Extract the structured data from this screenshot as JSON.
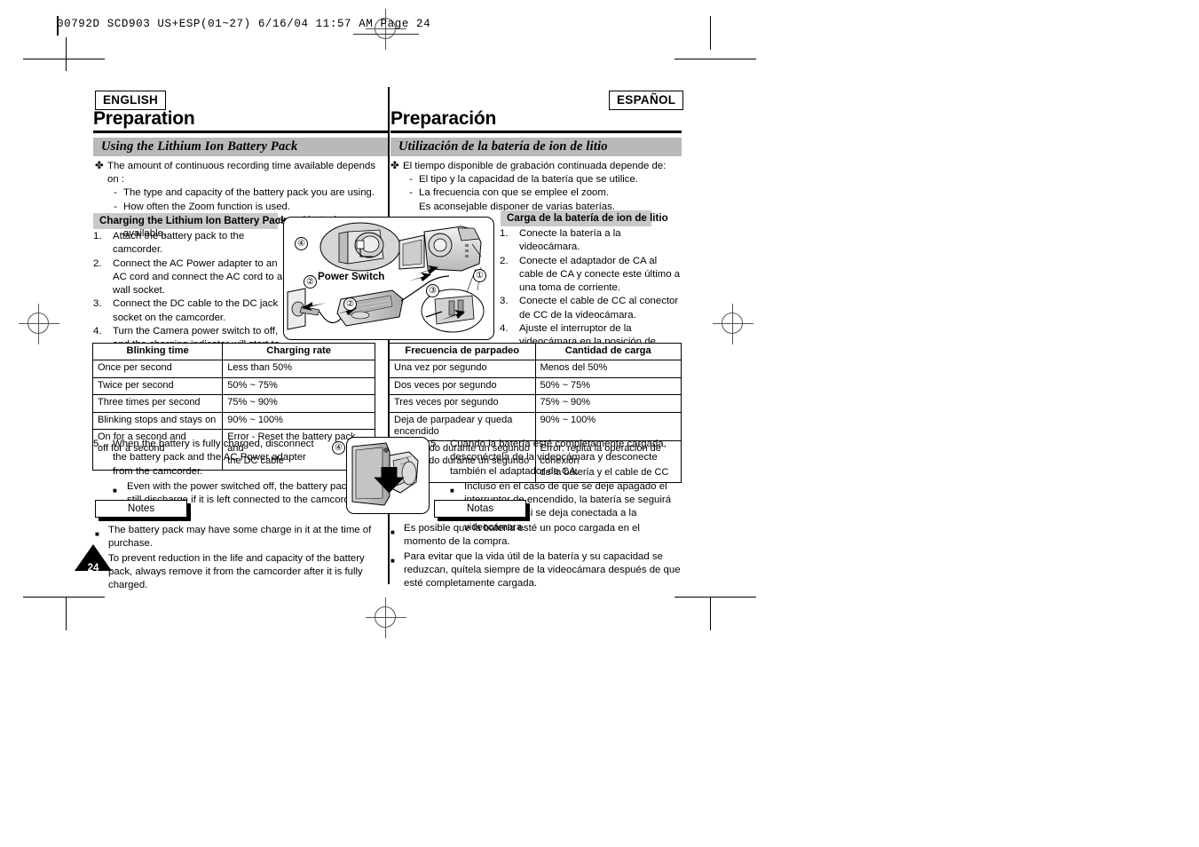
{
  "file_header": {
    "text": "00792D  SCD903  US+ESP(01~27)   6/16/04  11:57 AM   Page 24"
  },
  "page_number": "24",
  "english": {
    "lang_tag": "ENGLISH",
    "title": "Preparation",
    "section_heading": "Using the Lithium Ion Battery Pack",
    "intro": {
      "lead": "The amount of continuous recording time available depends on :",
      "sub_items": [
        "The type and capacity of the battery pack you are using.",
        "How often the Zoom function is used."
      ],
      "note_line": "It is recommended that you have several batteries available."
    },
    "charging_heading": "Charging the Lithium Ion Battery Pack",
    "steps": [
      {
        "num": "1.",
        "text": "Attach the battery pack to the camcorder."
      },
      {
        "num": "2.",
        "text": "Connect the AC Power adapter to an AC cord and connect the AC cord to a wall socket."
      },
      {
        "num": "3.",
        "text": "Connect the DC cable to the DC jack socket on the camcorder."
      },
      {
        "num": "4.",
        "text": "Turn the Camera power switch to off, and the charging indicator will start to flash, showing that the battery is charging."
      }
    ],
    "table": {
      "headers": [
        "Blinking time",
        "Charging rate"
      ],
      "rows": [
        [
          "Once per second",
          "Less than 50%"
        ],
        [
          "Twice per second",
          "50% ~ 75%"
        ],
        [
          "Three times per second",
          "75%  ~  90%"
        ],
        [
          "Blinking stops and stays on",
          "90% ~ 100%"
        ],
        [
          "On for a second and\noff for a second",
          "Error - Reset the battery pack and\nthe DC cable"
        ]
      ]
    },
    "step5": {
      "num": "5.",
      "text": "When the battery is fully charged, disconnect the battery pack and the AC Power adapter from the camcorder.",
      "sub": "Even with the power switched off, the battery pack will still discharge if it is left connected to the camcorder."
    },
    "notes_label": "Notes",
    "notes": [
      "The battery pack may have some charge in it at the time of purchase.",
      "To prevent reduction in the life and capacity of the battery pack, always remove it from the camcorder after it is fully charged."
    ]
  },
  "spanish": {
    "lang_tag": "ESPAÑOL",
    "title": "Preparación",
    "section_heading": "Utilización de la batería de ion de litio",
    "intro": {
      "lead": "El tiempo disponible de grabación continuada depende de:",
      "sub_items": [
        "El tipo y la capacidad de la batería que se utilice.",
        "La frecuencia con que se emplee el zoom."
      ],
      "note_line": "Es aconsejable disponer de varias baterías."
    },
    "charging_heading": "Carga de la batería de ion de litio",
    "steps": [
      {
        "num": "1.",
        "text": "Conecte la batería a la videocámara."
      },
      {
        "num": "2.",
        "text": "Conecte el adaptador de CA al cable de CA y conecte este último a una toma de corriente."
      },
      {
        "num": "3.",
        "text": "Conecte el cable de CC al conector de CC de la videocámara."
      },
      {
        "num": "4.",
        "text": "Ajuste el interruptor de la videocámara en la posición de apagado. El indicador de carga empezará a parpadear, lo que indica que la batería se está cargando."
      }
    ],
    "table": {
      "headers": [
        "Frecuencia de parpadeo",
        "Cantidad de carga"
      ],
      "rows": [
        [
          "Una vez por segundo",
          "Menos del 50%"
        ],
        [
          "Dos veces por segundo",
          "50% ~ 75%"
        ],
        [
          "Tres veces por segundo",
          "75%  ~  90%"
        ],
        [
          "Deja de parpadear y queda encendido",
          "90% ~ 100%"
        ],
        [
          "Encendido durante un segundo\ny apagado durante un segundo",
          "Error: repita la operación de conexión\nde la batería y el cable de CC"
        ]
      ]
    },
    "step5": {
      "num": "5.",
      "text": "Cuando la batería esté completamente cargada, desconéctela de la videocámara y desconecte también el adaptador de CA.",
      "sub": "Incluso en el caso de que se deje apagado el interruptor de encendido, la batería se seguirá descargando si se deja conectada a la videocámara."
    },
    "notes_label": "Notas",
    "notes": [
      "Es posible que la batería esté un poco cargada en el momento de la compra.",
      "Para evitar que la vida útil de la batería y su capacidad se reduzcan, quítela siempre de la videocámara después de que esté completamente cargada."
    ]
  },
  "illustration_main": {
    "power_switch_label": "Power Switch",
    "callouts": [
      "④",
      "②",
      "②",
      "③",
      "①"
    ]
  },
  "illustration_step5": {
    "callout": "④"
  }
}
